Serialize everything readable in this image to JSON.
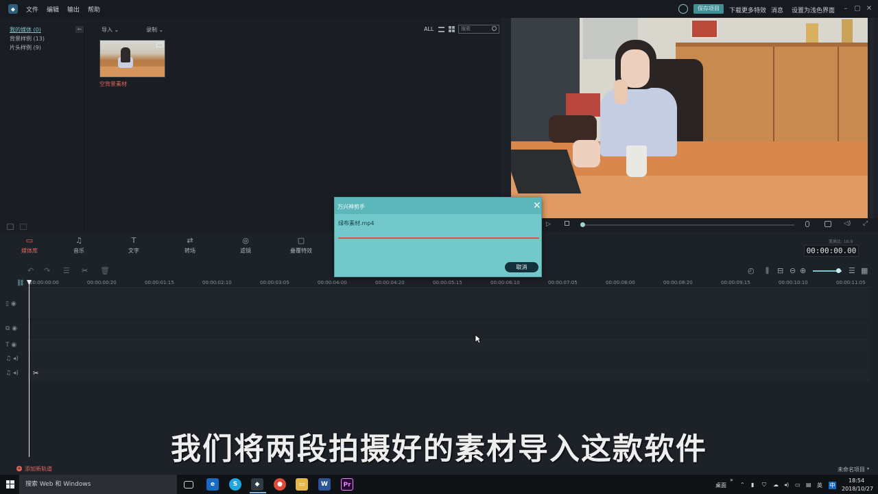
{
  "titlebar": {
    "menus": [
      "文件",
      "编辑",
      "输出",
      "帮助"
    ],
    "save_project": "保存项目",
    "download_effects": "下载更多特效",
    "messages": "消息",
    "settings": "设置为浅色界面"
  },
  "library": {
    "items": [
      {
        "label": "我的媒体 (0)"
      },
      {
        "label": "背景样例 (13)"
      },
      {
        "label": "片头样例 (9)"
      }
    ],
    "import_label": "导入",
    "record_label": "录制",
    "all_label": "ALL",
    "search_placeholder": "搜索",
    "media": [
      {
        "name": "空背景素材"
      }
    ]
  },
  "tools": [
    {
      "label": "媒体库",
      "icon": "folder-icon",
      "glyph": "▭"
    },
    {
      "label": "音乐",
      "icon": "music-icon",
      "glyph": "♫"
    },
    {
      "label": "文字",
      "icon": "text-icon",
      "glyph": "T"
    },
    {
      "label": "转场",
      "icon": "transition-icon",
      "glyph": "⇄"
    },
    {
      "label": "滤镜",
      "icon": "filter-icon",
      "glyph": "◎"
    },
    {
      "label": "叠覆特效",
      "icon": "overlay-icon",
      "glyph": "▢"
    }
  ],
  "timecode": "00:00:00.00",
  "ratio_label": "宽高比: 16:9",
  "ruler_ticks": [
    "00:00:00:00",
    "00:00:00:20",
    "00:00:01:15",
    "00:00:02:10",
    "00:00:03:05",
    "00:00:04:00",
    "00:00:04:20",
    "00:00:05:15",
    "00:00:06:10",
    "00:00:07:05",
    "00:00:08:00",
    "00:00:08:20",
    "00:00:09:15",
    "00:00:10:10",
    "00:00:11:05"
  ],
  "dialog": {
    "title": "万兴神剪手",
    "file": "绿布素材.mp4",
    "progress": 1.0,
    "cancel": "取消"
  },
  "subtitle": "我们将两段拍摄好的素材导入这款软件",
  "add_track": "添加新轨道",
  "project_name": "未命名项目 *",
  "taskbar": {
    "search": "搜索 Web 和 Windows",
    "tray_desktop": "桌面",
    "ime": "英",
    "time": "18:54",
    "date": "2018/10/27"
  },
  "colors": {
    "accent": "#e0675c",
    "teal": "#72c8ca"
  }
}
